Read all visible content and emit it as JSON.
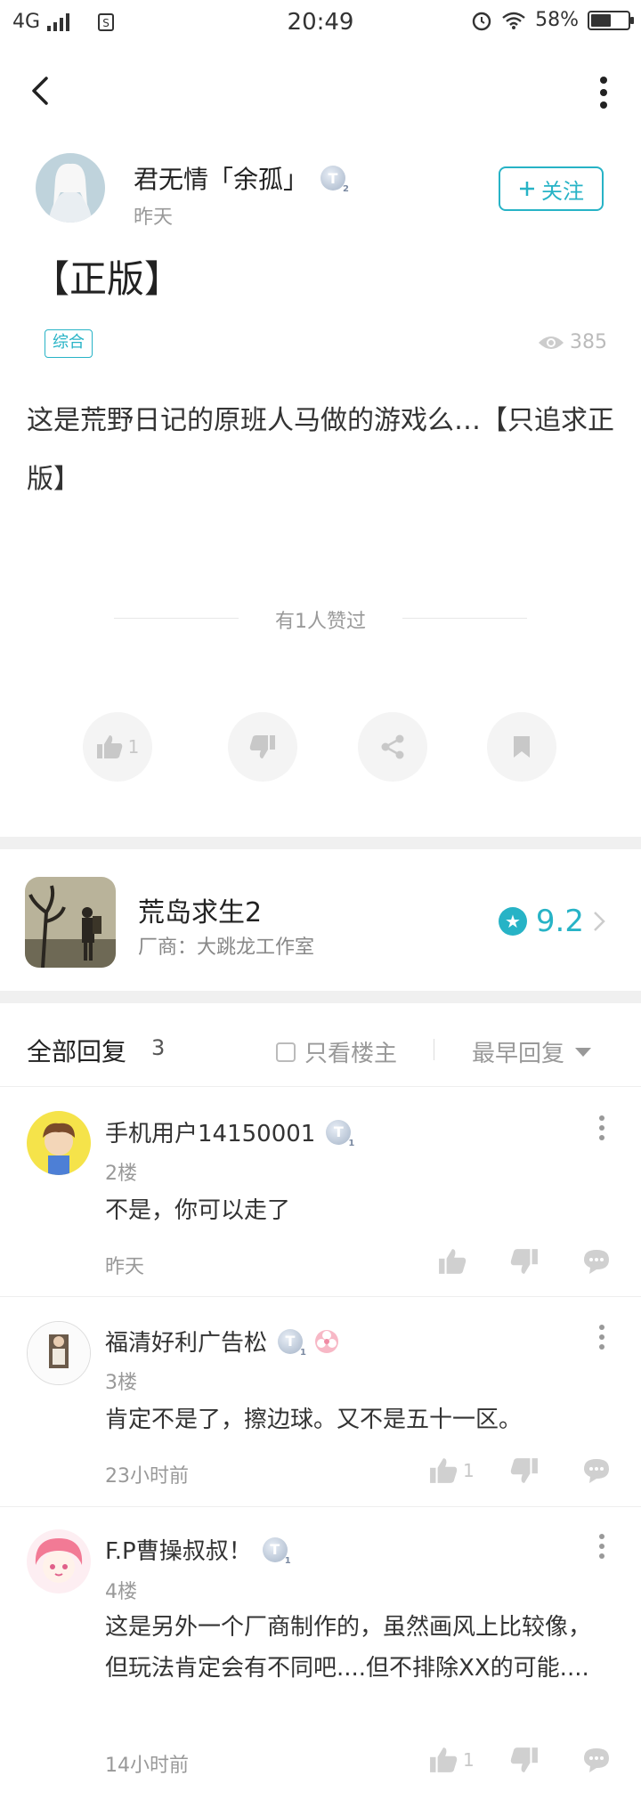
{
  "status_bar": {
    "network": "4G",
    "time": "20:49",
    "battery": "58%"
  },
  "post": {
    "author": "君无情「余孤」",
    "time": "昨天",
    "follow_label": "关注",
    "title": "【正版】",
    "tag": "综合",
    "views": "385",
    "content": "这是荒野日记的原班人马做的游戏么…【只追求正版】",
    "liked_text": "有1人赞过",
    "like_count": "1"
  },
  "game": {
    "name": "荒岛求生2",
    "developer": "厂商：大跳龙工作室",
    "score": "9.2"
  },
  "replies_header": {
    "title": "全部回复",
    "count": "3",
    "only_owner": "只看楼主",
    "sort": "最早回复"
  },
  "comments": [
    {
      "name": "手机用户14150001",
      "floor": "2楼",
      "text": "不是，你可以走了",
      "time": "昨天",
      "likes": ""
    },
    {
      "name": "福清好利广告松",
      "floor": "3楼",
      "text": "肯定不是了，擦边球。又不是五十一区。",
      "time": "23小时前",
      "likes": "1"
    },
    {
      "name": "F.P曹操叔叔！",
      "floor": "4楼",
      "text": "这是另外一个厂商制作的，虽然画风上比较像，但玩法肯定会有不同吧....但不排除XX的可能....",
      "time": "14小时前",
      "likes": "1"
    }
  ],
  "badge_letter": "T",
  "colors": {
    "accent": "#27b3c6"
  }
}
